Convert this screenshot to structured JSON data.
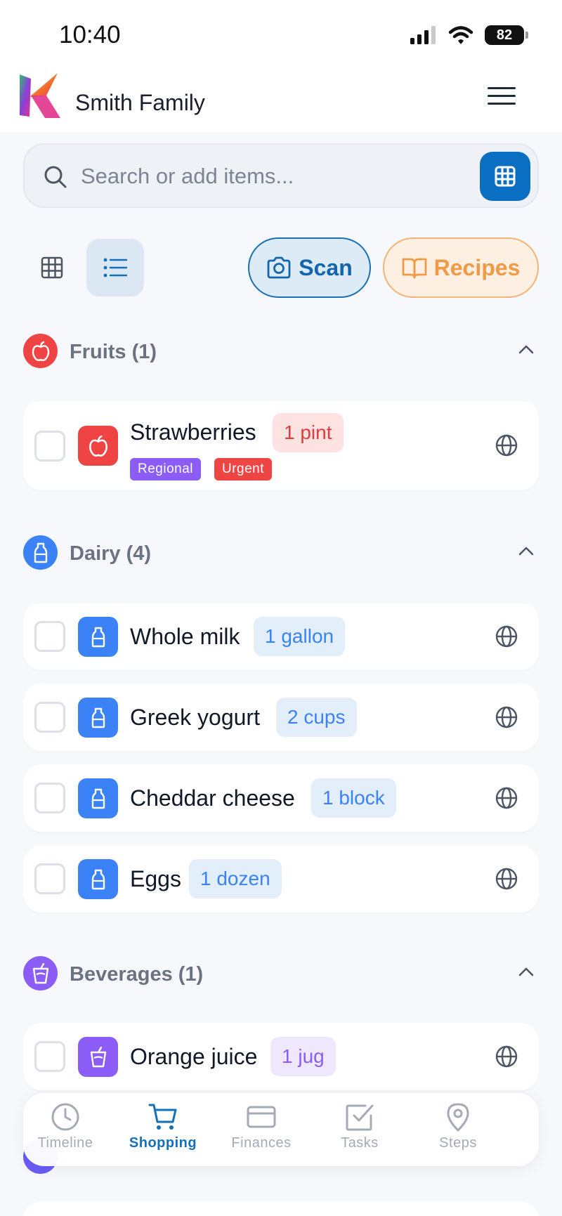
{
  "status_bar": {
    "time": "10:40",
    "battery": "82"
  },
  "header": {
    "title": "Smith Family"
  },
  "search": {
    "placeholder": "Search or add items..."
  },
  "toolbar": {
    "scan_label": "Scan",
    "recipes_label": "Recipes"
  },
  "colors": {
    "primary": "#0a6fc2",
    "fruits": "#ef4444",
    "dairy": "#3b82f6",
    "beverages": "#8b5cf6",
    "recipes": "#f19a45"
  },
  "categories": [
    {
      "name": "Fruits (1)",
      "icon": "apple-icon",
      "items": [
        {
          "name": "Strawberries",
          "qty": "1 pint",
          "tags": [
            "Regional",
            "Urgent"
          ]
        }
      ]
    },
    {
      "name": "Dairy (4)",
      "icon": "milk-bottle-icon",
      "items": [
        {
          "name": "Whole milk",
          "qty": "1 gallon"
        },
        {
          "name": "Greek yogurt",
          "qty": "2 cups"
        },
        {
          "name": "Cheddar cheese",
          "qty": "1 block"
        },
        {
          "name": "Eggs",
          "qty": "1 dozen"
        }
      ]
    },
    {
      "name": "Beverages (1)",
      "icon": "cup-icon",
      "items": [
        {
          "name": "Orange juice",
          "qty": "1 jug"
        }
      ]
    }
  ],
  "nav": [
    {
      "label": "Timeline",
      "icon": "clock-icon"
    },
    {
      "label": "Shopping",
      "icon": "cart-icon",
      "active": true
    },
    {
      "label": "Finances",
      "icon": "card-icon"
    },
    {
      "label": "Tasks",
      "icon": "checkbox-icon"
    },
    {
      "label": "Steps",
      "icon": "location-pin-icon"
    }
  ]
}
